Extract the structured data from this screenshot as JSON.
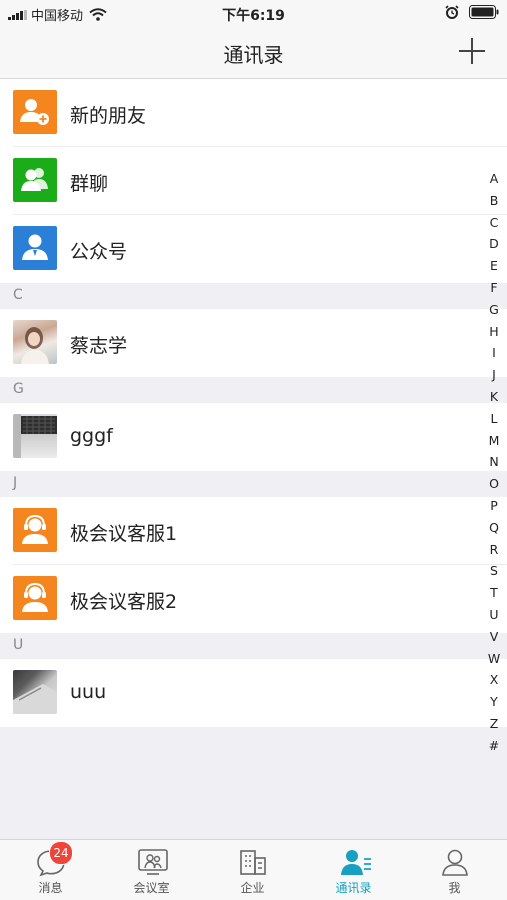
{
  "status_bar": {
    "carrier": "中国移动",
    "time": "下午6:19"
  },
  "nav": {
    "title": "通讯录"
  },
  "system_items": [
    {
      "label": "新的朋友",
      "icon": "new-friend-icon",
      "color": "#f5861f"
    },
    {
      "label": "群聊",
      "icon": "group-chat-icon",
      "color": "#1aad19"
    },
    {
      "label": "公众号",
      "icon": "official-account-icon",
      "color": "#2b7fd7"
    }
  ],
  "sections": [
    {
      "letter": "C",
      "contacts": [
        {
          "name": "蔡志学",
          "avatar": "photo-avatar"
        }
      ]
    },
    {
      "letter": "G",
      "contacts": [
        {
          "name": "gggf",
          "avatar": "photo-avatar"
        }
      ]
    },
    {
      "letter": "J",
      "contacts": [
        {
          "name": "极会议客服1",
          "avatar": "customer-service-icon",
          "color": "#f5861f"
        },
        {
          "name": "极会议客服2",
          "avatar": "customer-service-icon",
          "color": "#f5861f"
        }
      ]
    },
    {
      "letter": "U",
      "contacts": [
        {
          "name": "uuu",
          "avatar": "photo-avatar"
        }
      ]
    }
  ],
  "index_letters": [
    "A",
    "B",
    "C",
    "D",
    "E",
    "F",
    "G",
    "H",
    "I",
    "J",
    "K",
    "L",
    "M",
    "N",
    "O",
    "P",
    "Q",
    "R",
    "S",
    "T",
    "U",
    "V",
    "W",
    "X",
    "Y",
    "Z",
    "#"
  ],
  "tabs": [
    {
      "label": "消息",
      "badge": "24"
    },
    {
      "label": "会议室"
    },
    {
      "label": "企业"
    },
    {
      "label": "通讯录",
      "active": true
    },
    {
      "label": "我"
    }
  ],
  "colors": {
    "accent": "#17a0c2",
    "badge": "#f04438"
  }
}
